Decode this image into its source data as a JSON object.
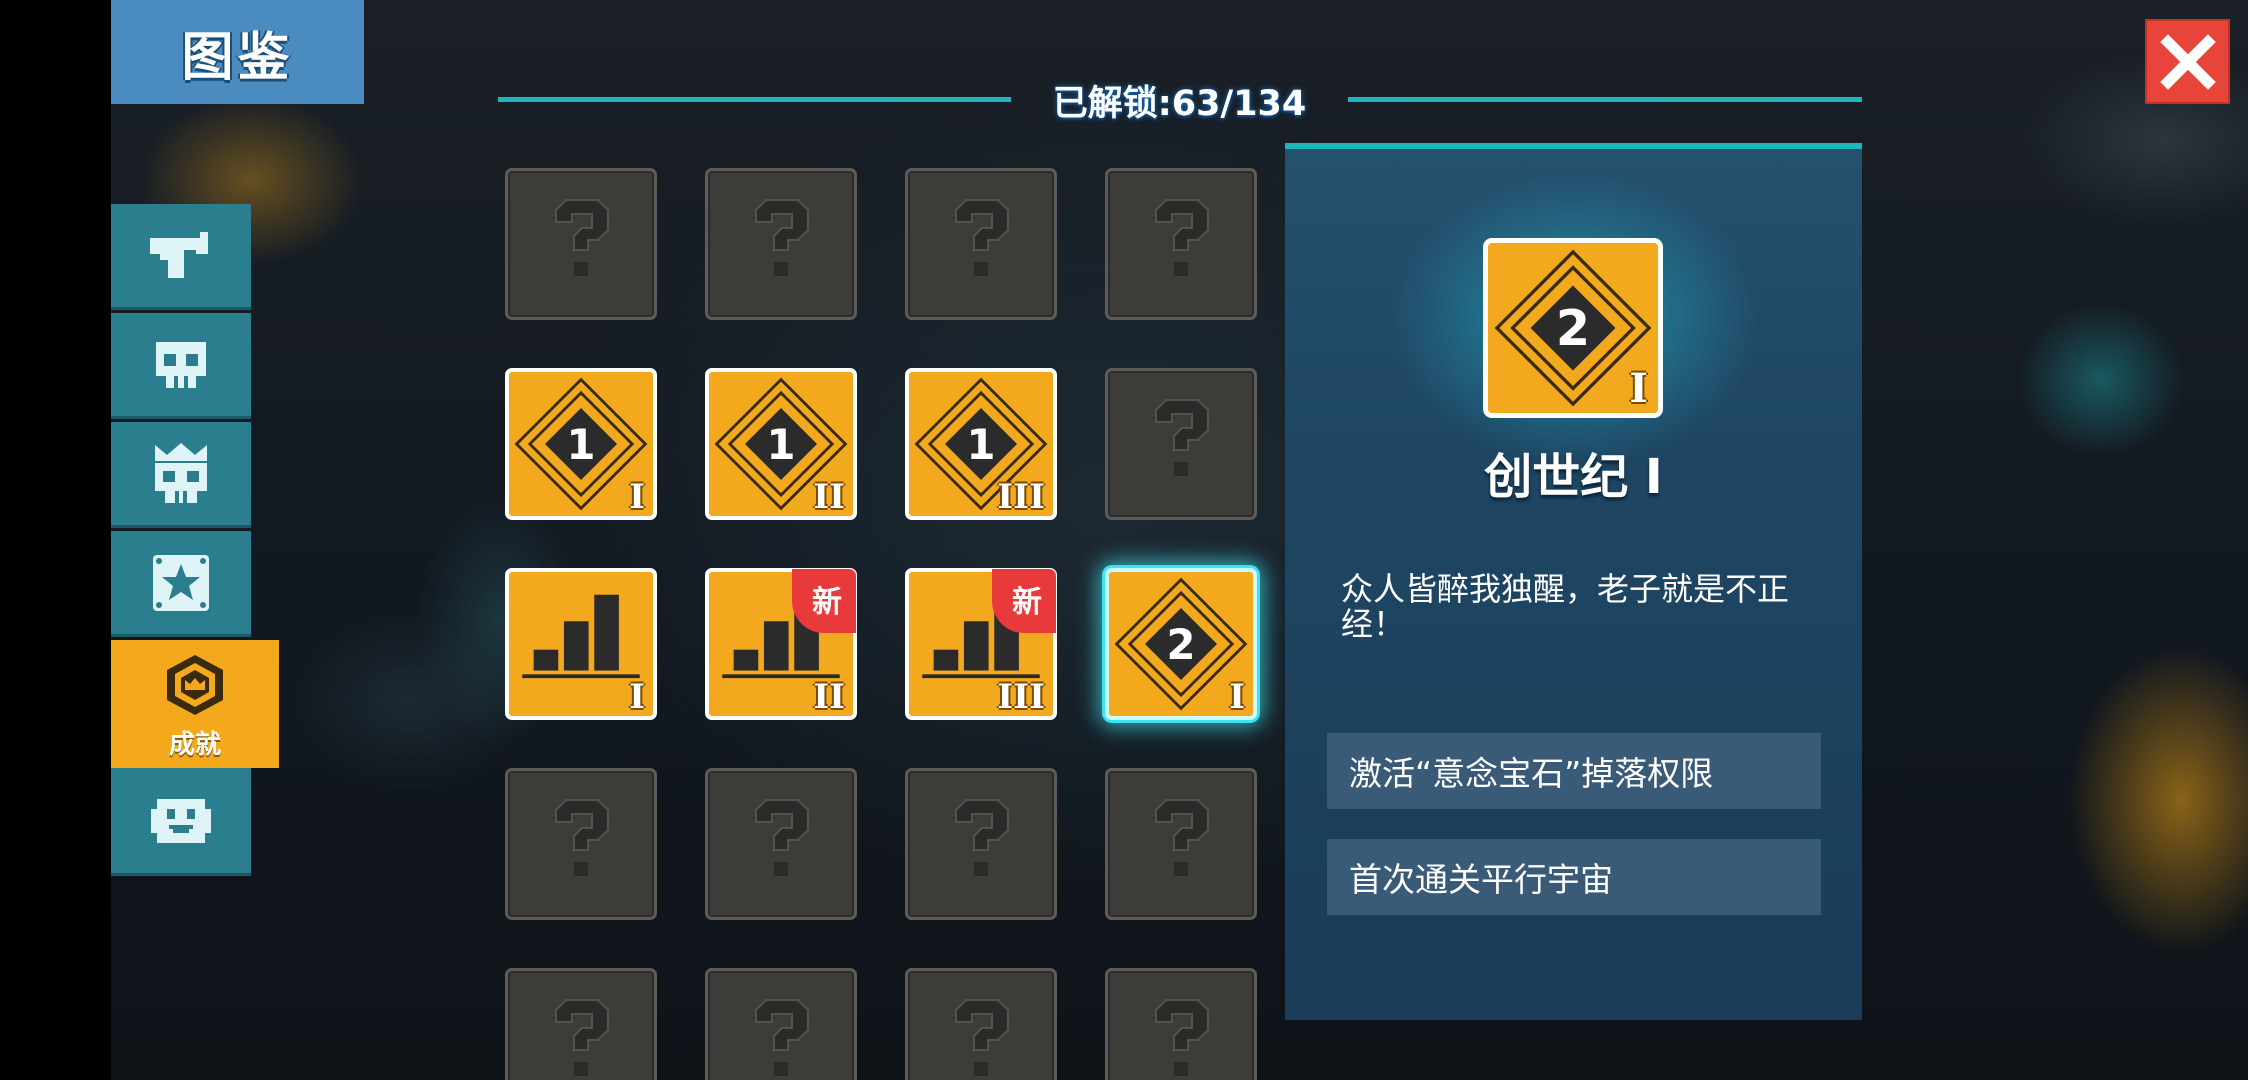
{
  "codex_title": "图鉴",
  "unlock_counter": "已解锁:63/134",
  "sidebar": {
    "tabs": [
      {
        "id": "weapons",
        "icon": "pistol-icon"
      },
      {
        "id": "enemies",
        "icon": "skull-icon"
      },
      {
        "id": "bosses",
        "icon": "crowned-skull-icon"
      },
      {
        "id": "items",
        "icon": "star-box-icon"
      },
      {
        "id": "achievements",
        "icon": "crown-badge-icon",
        "label": "成就",
        "active": true
      },
      {
        "id": "characters",
        "icon": "smiley-face-icon"
      }
    ]
  },
  "grid": {
    "rows": [
      [
        {
          "state": "locked"
        },
        {
          "state": "locked"
        },
        {
          "state": "locked"
        },
        {
          "state": "locked"
        }
      ],
      [
        {
          "state": "unlocked",
          "emblem": "diamond",
          "number": "1",
          "tier": "I"
        },
        {
          "state": "unlocked",
          "emblem": "diamond",
          "number": "1",
          "tier": "II"
        },
        {
          "state": "unlocked",
          "emblem": "diamond",
          "number": "1",
          "tier": "III"
        },
        {
          "state": "locked"
        }
      ],
      [
        {
          "state": "unlocked",
          "emblem": "bars",
          "tier": "I"
        },
        {
          "state": "unlocked",
          "emblem": "bars",
          "tier": "II",
          "badge": "新"
        },
        {
          "state": "unlocked",
          "emblem": "bars",
          "tier": "III",
          "badge": "新"
        },
        {
          "state": "unlocked",
          "emblem": "diamond",
          "number": "2",
          "tier": "I",
          "selected": true
        }
      ],
      [
        {
          "state": "locked"
        },
        {
          "state": "locked"
        },
        {
          "state": "locked"
        },
        {
          "state": "locked"
        }
      ],
      [
        {
          "state": "locked"
        },
        {
          "state": "locked"
        },
        {
          "state": "locked"
        },
        {
          "state": "locked"
        }
      ]
    ]
  },
  "detail": {
    "icon_number": "2",
    "icon_tier": "I",
    "name": "创世纪 I",
    "description": "众人皆醉我独醒，老子就是不正经！",
    "rewards": [
      "激活“意念宝石”掉落权限",
      "首次通关平行宇宙"
    ]
  },
  "colors": {
    "accent_cyan": "#1fb5bf",
    "achievement_orange": "#f2a91d",
    "new_badge_red": "#e83a3a",
    "close_red": "#e8453a",
    "sidebar_teal": "#2a7e8e",
    "title_blue": "#4a8bc0"
  }
}
